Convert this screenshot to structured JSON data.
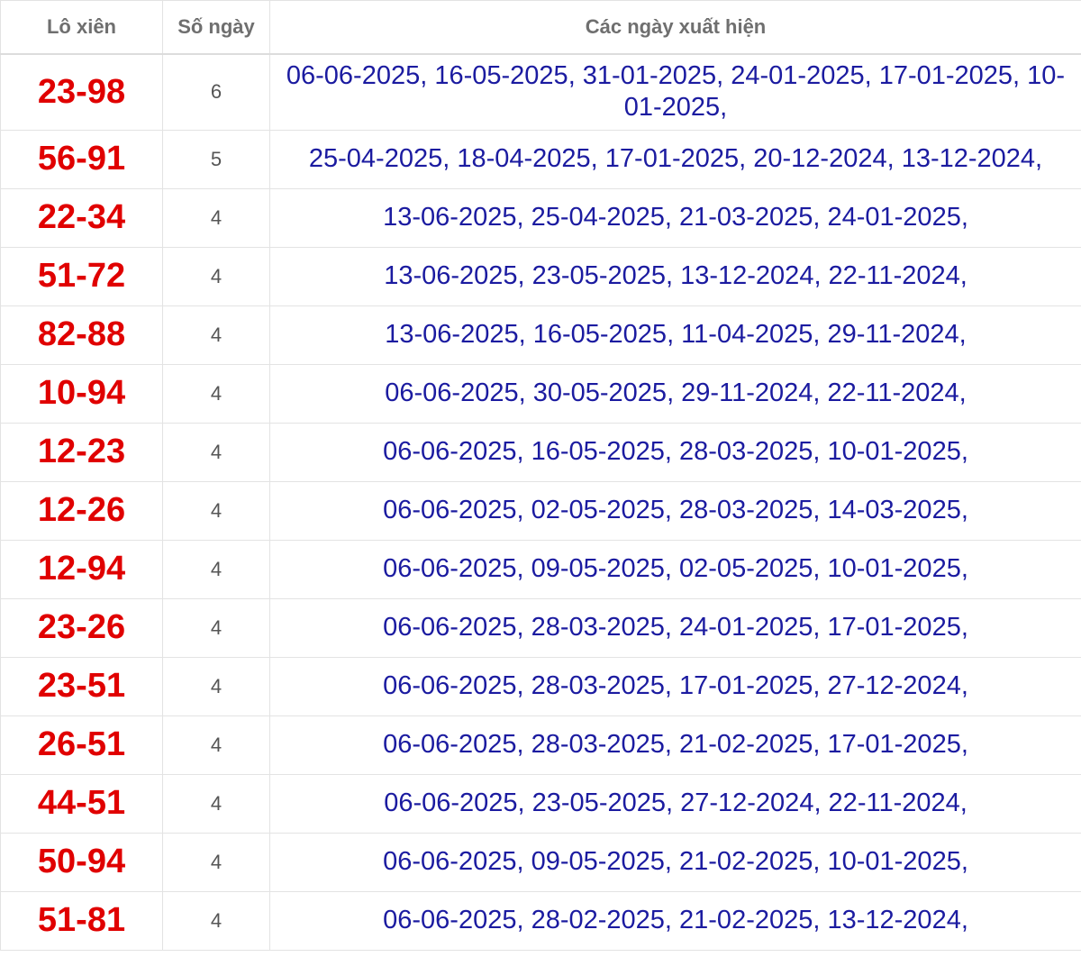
{
  "headers": {
    "pair": "Lô xiên",
    "count": "Số ngày",
    "dates": "Các ngày xuất hiện"
  },
  "rows": [
    {
      "pair": "23-98",
      "count": "6",
      "dates": "06-06-2025, 16-05-2025, 31-01-2025, 24-01-2025, 17-01-2025, 10-01-2025,"
    },
    {
      "pair": "56-91",
      "count": "5",
      "dates": "25-04-2025, 18-04-2025, 17-01-2025, 20-12-2024, 13-12-2024,"
    },
    {
      "pair": "22-34",
      "count": "4",
      "dates": "13-06-2025, 25-04-2025, 21-03-2025, 24-01-2025,"
    },
    {
      "pair": "51-72",
      "count": "4",
      "dates": "13-06-2025, 23-05-2025, 13-12-2024, 22-11-2024,"
    },
    {
      "pair": "82-88",
      "count": "4",
      "dates": "13-06-2025, 16-05-2025, 11-04-2025, 29-11-2024,"
    },
    {
      "pair": "10-94",
      "count": "4",
      "dates": "06-06-2025, 30-05-2025, 29-11-2024, 22-11-2024,"
    },
    {
      "pair": "12-23",
      "count": "4",
      "dates": "06-06-2025, 16-05-2025, 28-03-2025, 10-01-2025,"
    },
    {
      "pair": "12-26",
      "count": "4",
      "dates": "06-06-2025, 02-05-2025, 28-03-2025, 14-03-2025,"
    },
    {
      "pair": "12-94",
      "count": "4",
      "dates": "06-06-2025, 09-05-2025, 02-05-2025, 10-01-2025,"
    },
    {
      "pair": "23-26",
      "count": "4",
      "dates": "06-06-2025, 28-03-2025, 24-01-2025, 17-01-2025,"
    },
    {
      "pair": "23-51",
      "count": "4",
      "dates": "06-06-2025, 28-03-2025, 17-01-2025, 27-12-2024,"
    },
    {
      "pair": "26-51",
      "count": "4",
      "dates": "06-06-2025, 28-03-2025, 21-02-2025, 17-01-2025,"
    },
    {
      "pair": "44-51",
      "count": "4",
      "dates": "06-06-2025, 23-05-2025, 27-12-2024, 22-11-2024,"
    },
    {
      "pair": "50-94",
      "count": "4",
      "dates": "06-06-2025, 09-05-2025, 21-02-2025, 10-01-2025,"
    },
    {
      "pair": "51-81",
      "count": "4",
      "dates": "06-06-2025, 28-02-2025, 21-02-2025, 13-12-2024,"
    }
  ],
  "colors": {
    "pair": "#e00000",
    "dates": "#1b1ba0",
    "count": "#555555",
    "header": "#6f6f6f"
  }
}
